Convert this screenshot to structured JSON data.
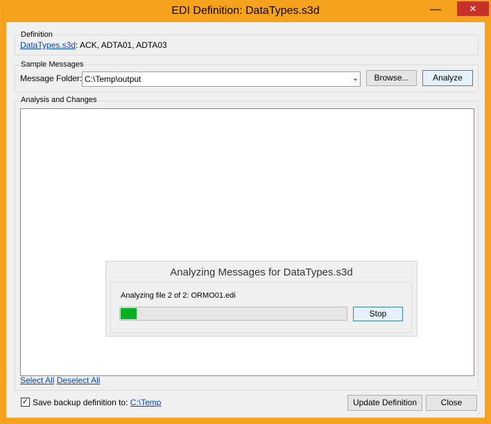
{
  "window": {
    "title": "EDI Definition: DataTypes.s3d",
    "minimize_glyph": "—",
    "maximize_glyph": "☐",
    "close_glyph": "✕"
  },
  "definition": {
    "group_label": "Definition",
    "file_link": "DataTypes.s3d",
    "segments": ": ACK, ADTA01, ADTA03"
  },
  "sample_messages": {
    "group_label": "Sample Messages",
    "folder_label": "Message Folder:",
    "folder_value": "C:\\Temp\\output",
    "browse_label": "Browse...",
    "analyze_label": "Analyze"
  },
  "analysis": {
    "group_label": "Analysis and Changes",
    "select_all": "Select All",
    "deselect_all": "Deselect All"
  },
  "progress_dialog": {
    "title": "Analyzing Messages for DataTypes.s3d",
    "status": "Analyzing file 2 of 2: ORMO01.edi",
    "progress": 0.07,
    "progress_color": "#06b025",
    "stop_label": "Stop"
  },
  "footer": {
    "backup_checked": true,
    "backup_label": "Save backup definition to:",
    "backup_path": "C:\\Temp",
    "update_label": "Update Definition",
    "close_label": "Close"
  }
}
